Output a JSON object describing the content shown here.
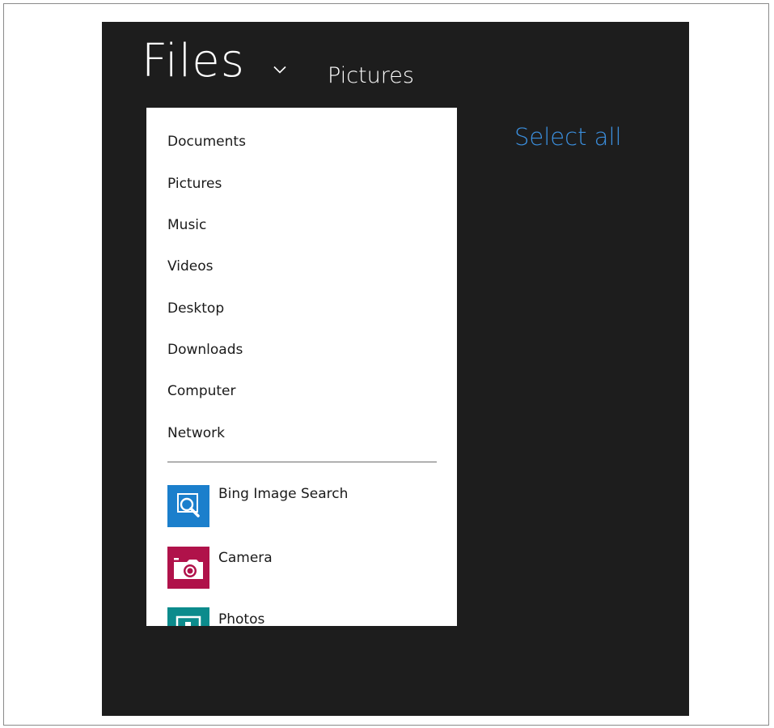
{
  "header": {
    "title": "Files",
    "current_location": "Pictures"
  },
  "actions": {
    "select_all": "Select all"
  },
  "menu": {
    "locations": [
      {
        "label": "Documents"
      },
      {
        "label": "Pictures"
      },
      {
        "label": "Music"
      },
      {
        "label": "Videos"
      },
      {
        "label": "Desktop"
      },
      {
        "label": "Downloads"
      },
      {
        "label": "Computer"
      },
      {
        "label": "Network"
      }
    ],
    "apps": [
      {
        "label": "Bing Image Search",
        "icon": "bing-image-search-icon",
        "color": "#1b7fcc"
      },
      {
        "label": "Camera",
        "icon": "camera-icon",
        "color": "#b0124a"
      },
      {
        "label": "Photos",
        "icon": "photos-icon",
        "color": "#0c8b8c"
      }
    ]
  },
  "colors": {
    "background": "#1d1d1d",
    "accent": "#3b8fde",
    "menu_background": "#ffffff"
  }
}
